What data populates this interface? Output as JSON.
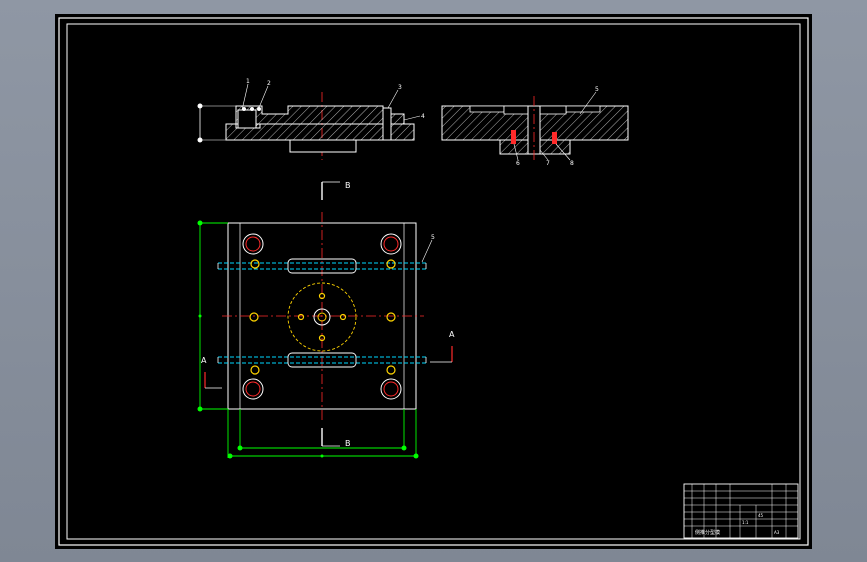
{
  "colors": {
    "background": "#000000",
    "frame": "#ffffff",
    "center_line": "#ff2a2a",
    "hidden_line": "#00d8ff",
    "bolt": "#ffd400",
    "dimension": "#00ff00",
    "leader": "#ffffff"
  },
  "labels": {
    "section_b": "B",
    "section_a": "A",
    "part_1": "1",
    "part_2": "2",
    "part_3": "3",
    "part_4": "4",
    "part_5": "5",
    "part_6": "6",
    "part_7": "7",
    "part_8": "8"
  },
  "title_block": {
    "drawing_name": "侧推分型模",
    "scale": "1:1",
    "sheet": "A3",
    "material": "45"
  }
}
